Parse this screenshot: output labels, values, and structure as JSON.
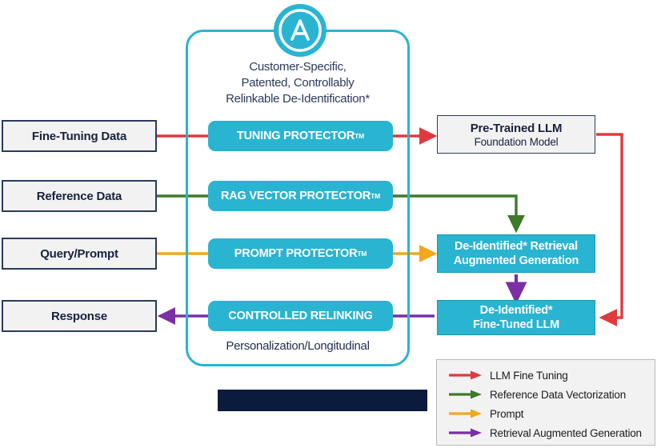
{
  "diagram": {
    "title_caption": [
      "Customer-Specific,",
      "Patented, Controllably",
      "Relinkable De-Identification*"
    ],
    "footer_caption": "Personalization/Longitudinal",
    "logo_letter": "A"
  },
  "inputs": [
    {
      "label": "Fine-Tuning Data"
    },
    {
      "label": "Reference Data"
    },
    {
      "label": "Query/Prompt"
    },
    {
      "label": "Response"
    }
  ],
  "protectors": [
    {
      "label": "TUNING PROTECTOR",
      "tm": "TM"
    },
    {
      "label": "RAG VECTOR PROTECTOR",
      "tm": "TM"
    },
    {
      "label": "PROMPT PROTECTOR",
      "tm": "TM"
    },
    {
      "label": "CONTROLLED RELINKING",
      "tm": ""
    }
  ],
  "outputs": {
    "pretrained": {
      "line1": "Pre-Trained LLM",
      "line2": "Foundation Model"
    },
    "rag": {
      "line1": "De-Identified* Retrieval",
      "line2": "Augmented Generation"
    },
    "finetuned": {
      "line1": "De-Identified*",
      "line2": "Fine-Tuned LLM"
    }
  },
  "legend": {
    "items": [
      {
        "label": "LLM Fine Tuning",
        "color": "#e03a3e"
      },
      {
        "label": "Reference Data Vectorization",
        "color": "#3f7a2a"
      },
      {
        "label": "Prompt",
        "color": "#f4a61c"
      },
      {
        "label": "Retrieval Augmented Generation",
        "color": "#7b2fa5"
      }
    ]
  },
  "colors": {
    "teal": "#29b4d1",
    "navy": "#2b3a5c",
    "red": "#e03a3e",
    "green": "#3f7a2a",
    "orange": "#f4a61c",
    "purple": "#7b2fa5",
    "redacted": "#0a1b3d"
  }
}
